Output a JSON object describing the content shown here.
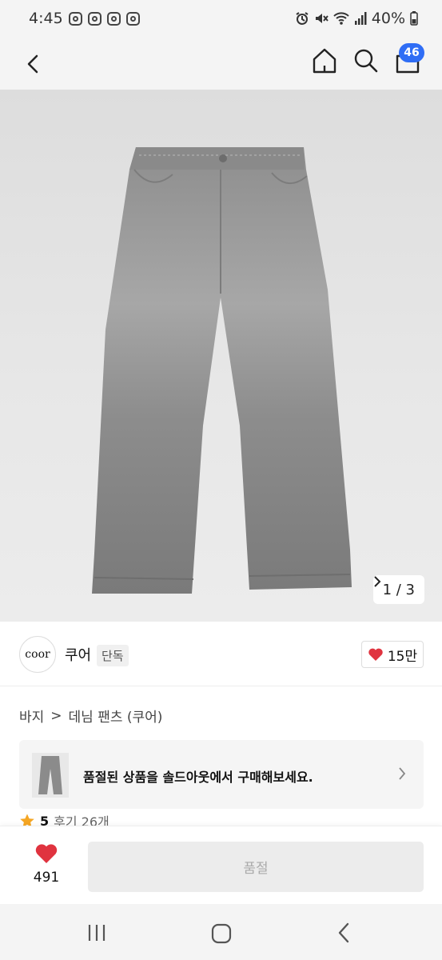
{
  "status_bar": {
    "time": "4:45",
    "battery": "40%",
    "notification_icons": [
      "instagram-icon",
      "instagram-icon",
      "instagram-icon",
      "instagram-icon"
    ],
    "system_icons": [
      "alarm-icon",
      "mute-icon",
      "wifi-icon",
      "signal-icon",
      "battery-icon"
    ]
  },
  "header": {
    "back_icon": "chevron-left-icon",
    "home_icon": "home-icon",
    "search_icon": "search-icon",
    "cart_icon": "shopping-bag-icon",
    "cart_count": "46",
    "badge_color": "#2f6df5"
  },
  "gallery": {
    "counter": "1 / 3",
    "next_icon": "chevron-right-icon"
  },
  "brand": {
    "logo_text": "coor",
    "name": "쿠어",
    "tag": "단독",
    "like_count": "15만",
    "like_icon": "heart-icon",
    "heart_color": "#e0333f"
  },
  "breadcrumb": {
    "items": [
      "바지",
      "데님 팬츠 (쿠어)"
    ],
    "separator": ">"
  },
  "soldout_banner": {
    "text": "품절된 상품을 솔드아웃에서 구매해보세요."
  },
  "rating": {
    "star_icon": "star-icon",
    "value": "5",
    "review_label": "후기 26개",
    "star_color": "#f5a623"
  },
  "bottom_bar": {
    "wish_count": "491",
    "action_label": "품절"
  },
  "nav_bar": {
    "icons": [
      "recent-apps-icon",
      "home-icon",
      "back-icon"
    ]
  }
}
